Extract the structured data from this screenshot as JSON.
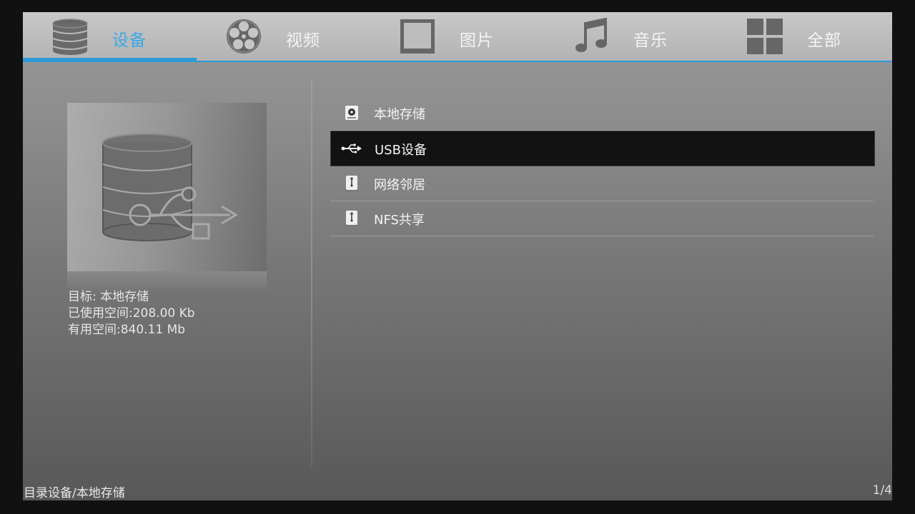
{
  "tabs": [
    {
      "label": "设备",
      "icon": "database-icon",
      "active": true
    },
    {
      "label": "视频",
      "icon": "film-reel-icon",
      "active": false
    },
    {
      "label": "图片",
      "icon": "picture-frame-icon",
      "active": false
    },
    {
      "label": "音乐",
      "icon": "music-note-icon",
      "active": false
    },
    {
      "label": "全部",
      "icon": "grid-icon",
      "active": false
    }
  ],
  "preview": {
    "icon": "database-usb-icon",
    "info": {
      "target": "目标: 本地存储",
      "used": "已使用空间:208.00 Kb",
      "free": "有用空间:840.11 Mb"
    }
  },
  "devices": [
    {
      "label": "本地存储",
      "icon": "local-disk-icon",
      "selected": false
    },
    {
      "label": "USB设备",
      "icon": "usb-icon",
      "selected": true
    },
    {
      "label": "网络邻居",
      "icon": "network-drive-icon",
      "selected": false
    },
    {
      "label": "NFS共享",
      "icon": "network-drive-icon",
      "selected": false
    }
  ],
  "footer": {
    "breadcrumb": "目录设备/本地存储",
    "page": "1/4"
  },
  "colors": {
    "accent": "#2e9ad8",
    "active_tab_text": "#3aa7e6",
    "selected_row": "#121212"
  }
}
